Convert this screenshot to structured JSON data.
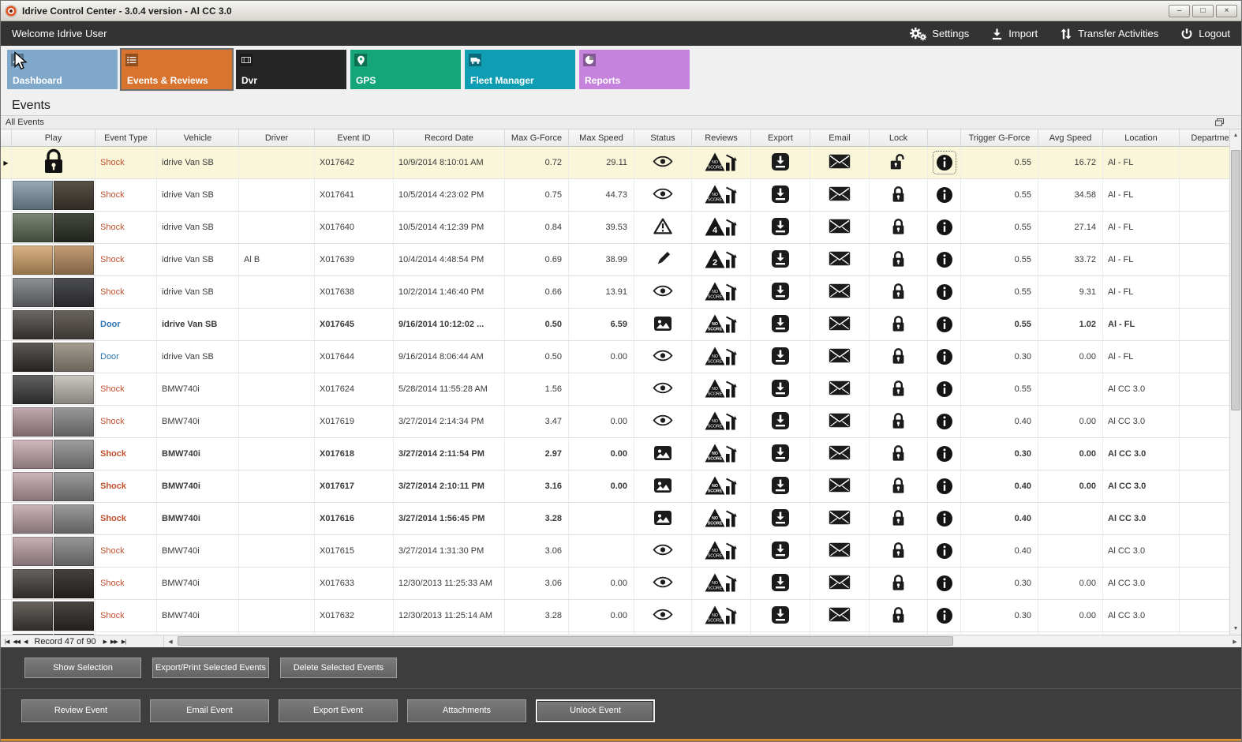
{
  "window": {
    "title": "Idrive Control Center - 3.0.4 version - Al CC 3.0",
    "buttons": [
      "minimize",
      "maximize",
      "close"
    ]
  },
  "topbar": {
    "welcome": "Welcome Idrive User",
    "actions": [
      {
        "id": "settings",
        "label": "Settings",
        "icon": "gear-icon"
      },
      {
        "id": "import",
        "label": "Import",
        "icon": "import-icon"
      },
      {
        "id": "transfer-activities",
        "label": "Transfer Activities",
        "icon": "transfer-icon"
      },
      {
        "id": "logout",
        "label": "Logout",
        "icon": "power-icon"
      }
    ]
  },
  "nav_tiles": [
    {
      "id": "dashboard",
      "label": "Dashboard",
      "color": "#7fa8cb",
      "selected": false,
      "icon": "dashboard-icon"
    },
    {
      "id": "events-reviews",
      "label": "Events & Reviews",
      "color": "#d9742f",
      "selected": true,
      "icon": "events-icon"
    },
    {
      "id": "dvr",
      "label": "Dvr",
      "color": "#262626",
      "selected": false,
      "icon": "dvr-icon"
    },
    {
      "id": "gps",
      "label": "GPS",
      "color": "#14a678",
      "selected": false,
      "icon": "gps-icon"
    },
    {
      "id": "fleet-manager",
      "label": "Fleet Manager",
      "color": "#0f9db4",
      "selected": false,
      "icon": "fleet-icon"
    },
    {
      "id": "reports",
      "label": "Reports",
      "color": "#c583dd",
      "selected": false,
      "icon": "reports-icon"
    }
  ],
  "page": {
    "title": "Events",
    "group_bar": "All Events"
  },
  "table": {
    "columns": [
      "Play",
      "Event Type",
      "Vehicle",
      "Driver",
      "Event ID",
      "Record Date",
      "Max G-Force",
      "Max Speed",
      "Status",
      "Reviews",
      "Export",
      "Email",
      "Lock",
      "",
      "Trigger G-Force",
      "Avg Speed",
      "Location",
      "Departme"
    ],
    "rows": [
      {
        "play": "lock",
        "thumb": [],
        "type": "Shock",
        "kind": "shock",
        "vehicle": "idrive Van SB",
        "driver": "",
        "event_id": "X017642",
        "record_date": "10/9/2014 8:10:01 AM",
        "max_g": "0.72",
        "max_speed": "29.11",
        "status": "eye",
        "review": "NO SCORE",
        "lock": "unlocked",
        "trigger_g": "0.55",
        "avg_speed": "16.72",
        "location": "Al - FL",
        "bold": false,
        "selected": true
      },
      {
        "play": "thumb",
        "thumb": [
          "#7f96a6",
          "#463e34"
        ],
        "type": "Shock",
        "kind": "shock",
        "vehicle": "idrive Van SB",
        "driver": "",
        "event_id": "X017641",
        "record_date": "10/5/2014 4:23:02 PM",
        "max_g": "0.75",
        "max_speed": "44.73",
        "status": "eye",
        "review": "NO SCORE",
        "lock": "locked",
        "trigger_g": "0.55",
        "avg_speed": "34.58",
        "location": "Al - FL",
        "bold": false,
        "selected": false
      },
      {
        "play": "thumb",
        "thumb": [
          "#5c6b54",
          "#30352a"
        ],
        "type": "Shock",
        "kind": "shock",
        "vehicle": "idrive Van SB",
        "driver": "",
        "event_id": "X017640",
        "record_date": "10/5/2014 4:12:39 PM",
        "max_g": "0.84",
        "max_speed": "39.53",
        "status": "warning",
        "review": "4",
        "lock": "locked",
        "trigger_g": "0.55",
        "avg_speed": "27.14",
        "location": "Al - FL",
        "bold": false,
        "selected": false
      },
      {
        "play": "thumb",
        "thumb": [
          "#d2a268",
          "#bd9266"
        ],
        "type": "Shock",
        "kind": "shock",
        "vehicle": "idrive Van SB",
        "driver": "Al B",
        "event_id": "X017639",
        "record_date": "10/4/2014 4:48:54 PM",
        "max_g": "0.69",
        "max_speed": "38.99",
        "status": "pencil",
        "review": "2",
        "lock": "locked",
        "trigger_g": "0.55",
        "avg_speed": "33.72",
        "location": "Al - FL",
        "bold": false,
        "selected": false
      },
      {
        "play": "thumb",
        "thumb": [
          "#73767a",
          "#393a3e"
        ],
        "type": "Shock",
        "kind": "shock",
        "vehicle": "idrive Van SB",
        "driver": "",
        "event_id": "X017638",
        "record_date": "10/2/2014 1:46:40 PM",
        "max_g": "0.66",
        "max_speed": "13.91",
        "status": "eye",
        "review": "NO SCORE",
        "lock": "locked",
        "trigger_g": "0.55",
        "avg_speed": "9.31",
        "location": "Al - FL",
        "bold": false,
        "selected": false
      },
      {
        "play": "thumb",
        "thumb": [
          "#46423e",
          "#58524a"
        ],
        "type": "Door",
        "kind": "door",
        "vehicle": "idrive Van SB",
        "driver": "",
        "event_id": "X017645",
        "record_date": "9/16/2014 10:12:02 ...",
        "max_g": "0.50",
        "max_speed": "6.59",
        "status": "image",
        "review": "NO SCORE",
        "lock": "locked",
        "trigger_g": "0.55",
        "avg_speed": "1.02",
        "location": "Al - FL",
        "bold": true,
        "selected": false
      },
      {
        "play": "thumb",
        "thumb": [
          "#34312e",
          "#9b9285"
        ],
        "type": "Door",
        "kind": "door",
        "vehicle": "idrive Van SB",
        "driver": "",
        "event_id": "X017644",
        "record_date": "9/16/2014 8:06:44 AM",
        "max_g": "0.50",
        "max_speed": "0.00",
        "status": "eye",
        "review": "NO SCORE",
        "lock": "locked",
        "trigger_g": "0.30",
        "avg_speed": "0.00",
        "location": "Al - FL",
        "bold": false,
        "selected": false
      },
      {
        "play": "thumb",
        "thumb": [
          "#3b3b3d",
          "#c6c2ba"
        ],
        "type": "Shock",
        "kind": "shock",
        "vehicle": "BMW740i",
        "driver": "",
        "event_id": "X017624",
        "record_date": "5/28/2014 11:55:28 AM",
        "max_g": "1.56",
        "max_speed": "",
        "status": "eye",
        "review": "NO SCORE",
        "lock": "locked",
        "trigger_g": "0.55",
        "avg_speed": "",
        "location": "Al CC 3.0",
        "bold": false,
        "selected": false
      },
      {
        "play": "thumb",
        "thumb": [
          "#b4959b",
          "#8e8e90"
        ],
        "type": "Shock",
        "kind": "shock",
        "vehicle": "BMW740i",
        "driver": "",
        "event_id": "X017619",
        "record_date": "3/27/2014 2:14:34 PM",
        "max_g": "3.47",
        "max_speed": "0.00",
        "status": "eye",
        "review": "NO SCORE",
        "lock": "locked",
        "trigger_g": "0.40",
        "avg_speed": "0.00",
        "location": "Al CC 3.0",
        "bold": false,
        "selected": false
      },
      {
        "play": "thumb",
        "thumb": [
          "#c6a8ae",
          "#949496"
        ],
        "type": "Shock",
        "kind": "shock",
        "vehicle": "BMW740i",
        "driver": "",
        "event_id": "X017618",
        "record_date": "3/27/2014 2:11:54 PM",
        "max_g": "2.97",
        "max_speed": "0.00",
        "status": "image",
        "review": "NO SCORE",
        "lock": "locked",
        "trigger_g": "0.30",
        "avg_speed": "0.00",
        "location": "Al CC 3.0",
        "bold": true,
        "selected": false
      },
      {
        "play": "thumb",
        "thumb": [
          "#c2a4aa",
          "#919193"
        ],
        "type": "Shock",
        "kind": "shock",
        "vehicle": "BMW740i",
        "driver": "",
        "event_id": "X017617",
        "record_date": "3/27/2014 2:10:11 PM",
        "max_g": "3.16",
        "max_speed": "0.00",
        "status": "image",
        "review": "NO SCORE",
        "lock": "locked",
        "trigger_g": "0.40",
        "avg_speed": "0.00",
        "location": "Al CC 3.0",
        "bold": true,
        "selected": false
      },
      {
        "play": "thumb",
        "thumb": [
          "#bfa2a8",
          "#8f8f91"
        ],
        "type": "Shock",
        "kind": "shock",
        "vehicle": "BMW740i",
        "driver": "",
        "event_id": "X017616",
        "record_date": "3/27/2014 1:56:45 PM",
        "max_g": "3.28",
        "max_speed": "",
        "status": "image",
        "review": "NO SCORE",
        "lock": "locked",
        "trigger_g": "0.40",
        "avg_speed": "",
        "location": "Al CC 3.0",
        "bold": true,
        "selected": false
      },
      {
        "play": "thumb",
        "thumb": [
          "#bb9ea4",
          "#8b8b8d"
        ],
        "type": "Shock",
        "kind": "shock",
        "vehicle": "BMW740i",
        "driver": "",
        "event_id": "X017615",
        "record_date": "3/27/2014 1:31:30 PM",
        "max_g": "3.06",
        "max_speed": "",
        "status": "eye",
        "review": "NO SCORE",
        "lock": "locked",
        "trigger_g": "0.40",
        "avg_speed": "",
        "location": "Al CC 3.0",
        "bold": false,
        "selected": false
      },
      {
        "play": "thumb",
        "thumb": [
          "#413c37",
          "#302c28"
        ],
        "type": "Shock",
        "kind": "shock",
        "vehicle": "BMW740i",
        "driver": "",
        "event_id": "X017633",
        "record_date": "12/30/2013 11:25:33 AM",
        "max_g": "3.06",
        "max_speed": "0.00",
        "status": "eye",
        "review": "NO SCORE",
        "lock": "locked",
        "trigger_g": "0.30",
        "avg_speed": "0.00",
        "location": "Al CC 3.0",
        "bold": false,
        "selected": false
      },
      {
        "play": "thumb",
        "thumb": [
          "#453f3a",
          "#342f2b"
        ],
        "type": "Shock",
        "kind": "shock",
        "vehicle": "BMW740i",
        "driver": "",
        "event_id": "X017632",
        "record_date": "12/30/2013 11:25:14 AM",
        "max_g": "3.28",
        "max_speed": "0.00",
        "status": "eye",
        "review": "NO SCORE",
        "lock": "locked",
        "trigger_g": "0.30",
        "avg_speed": "0.00",
        "location": "Al CC 3.0",
        "bold": false,
        "selected": false
      }
    ],
    "partial_row": {
      "thumb": [
        "#3b3733",
        "#2c2926"
      ]
    }
  },
  "pager": {
    "label": "Record 47 of 90"
  },
  "selection_panel": {
    "buttons": [
      "Show Selection",
      "Export/Print Selected Events",
      "Delete Selected  Events"
    ]
  },
  "action_panel": {
    "buttons": [
      "Review Event",
      "Email Event",
      "Export Event",
      "Attachments",
      "Unlock Event"
    ],
    "focused": "Unlock Event"
  },
  "colors": {
    "shock_text": "#c1502e",
    "door_text": "#2d74b5",
    "selected_row": "#f9f6da",
    "topbar": "#333333",
    "bottom_panel": "#3d3d3d",
    "bottom_strip": "#c9821f"
  }
}
